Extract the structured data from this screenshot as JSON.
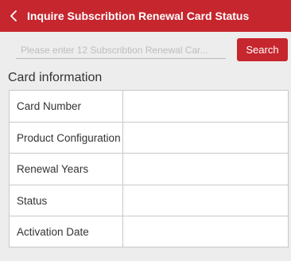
{
  "header": {
    "title": "Inquire Subscribtion Renewal Card Status",
    "back_icon": "chevron-left-icon",
    "color": "#c6262e"
  },
  "search": {
    "placeholder": "Please enter 12 Subscribtion Renewal Car...",
    "value": "",
    "button_label": "Search"
  },
  "card_info": {
    "title": "Card information",
    "rows": [
      {
        "label": "Card Number",
        "value": ""
      },
      {
        "label": "Product Configuration",
        "value": ""
      },
      {
        "label": "Renewal Years",
        "value": ""
      },
      {
        "label": "Status",
        "value": ""
      },
      {
        "label": "Activation Date",
        "value": ""
      }
    ]
  }
}
